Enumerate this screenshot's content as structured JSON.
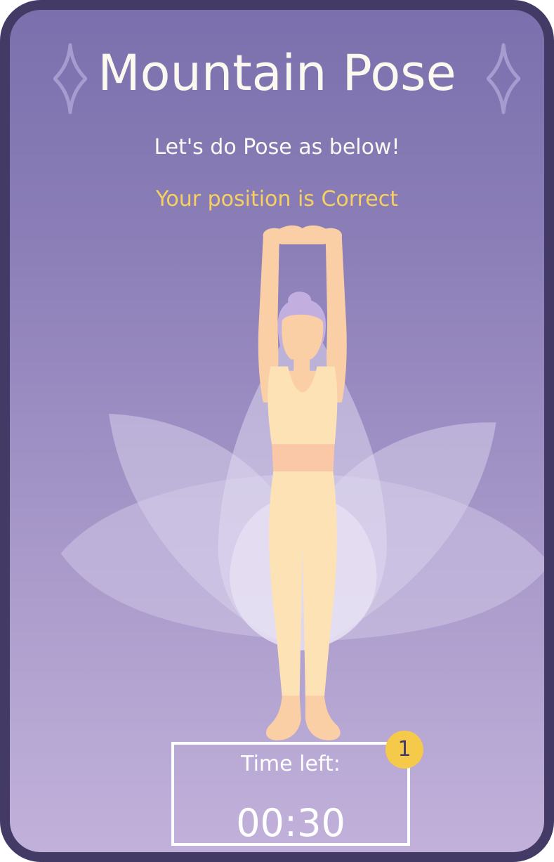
{
  "header": {
    "title": "Mountain Pose",
    "instruction": "Let's do Pose as below!",
    "status": "Your position is Correct"
  },
  "timer": {
    "label": "Time left:",
    "value": "00:30",
    "badge_count": "1"
  },
  "illustration": {
    "subject": "woman-in-mountain-pose",
    "background": "lotus-petals"
  },
  "colors": {
    "frame": "#433b65",
    "background_top": "#7b70ad",
    "background_bottom": "#c1b1da",
    "status_text": "#f6d060",
    "badge": "#f5c94a",
    "skin": "#fbcfa6",
    "clothing": "#fde2b6",
    "waistband": "#fbc8a7",
    "hair": "#c2afe0"
  },
  "icons": {
    "left_decoration": "sparkle-icon",
    "right_decoration": "sparkle-icon"
  }
}
